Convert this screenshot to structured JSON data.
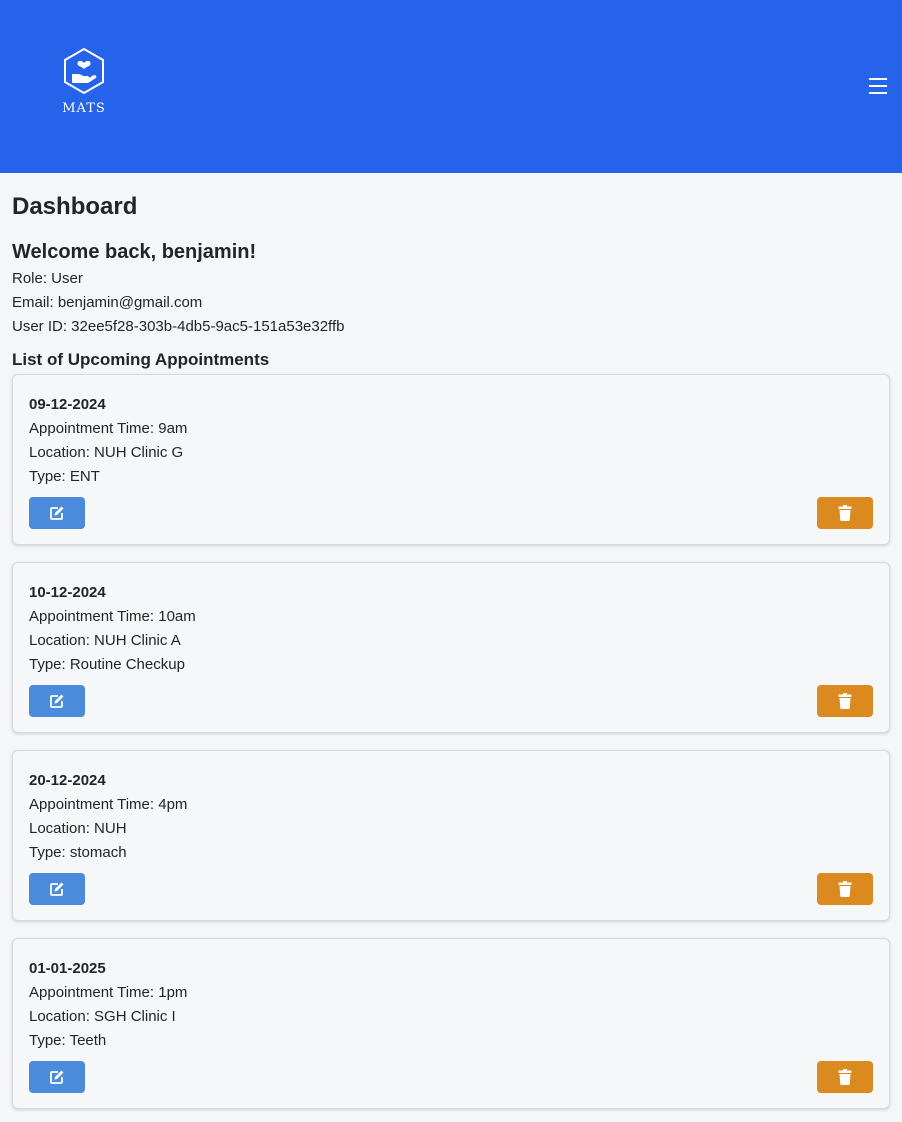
{
  "header": {
    "logo_text": "MATS",
    "brand_color": "#2563eb"
  },
  "dashboard": {
    "title": "Dashboard",
    "welcome": "Welcome back, benjamin!",
    "role": "Role: User",
    "email": "Email: benjamin@gmail.com",
    "user_id": "User ID: 32ee5f28-303b-4db5-9ac5-151a53e32ffb",
    "appointments_heading": "List of Upcoming Appointments"
  },
  "appointments": [
    {
      "date": "09-12-2024",
      "time": "Appointment Time: 9am",
      "location": "Location: NUH Clinic G",
      "type": "Type: ENT"
    },
    {
      "date": "10-12-2024",
      "time": "Appointment Time: 10am",
      "location": "Location: NUH Clinic A",
      "type": "Type: Routine Checkup"
    },
    {
      "date": "20-12-2024",
      "time": "Appointment Time: 4pm",
      "location": "Location: NUH",
      "type": "Type: stomach"
    },
    {
      "date": "01-01-2025",
      "time": "Appointment Time: 1pm",
      "location": "Location: SGH Clinic I",
      "type": "Type: Teeth"
    }
  ],
  "icons": {
    "logo": "hexagon-hand-heart-icon",
    "menu": "hamburger-menu-icon",
    "edit": "edit-icon",
    "delete": "trash-icon"
  },
  "colors": {
    "edit_button": "#4a8cdb",
    "delete_button": "#db8a1f"
  }
}
